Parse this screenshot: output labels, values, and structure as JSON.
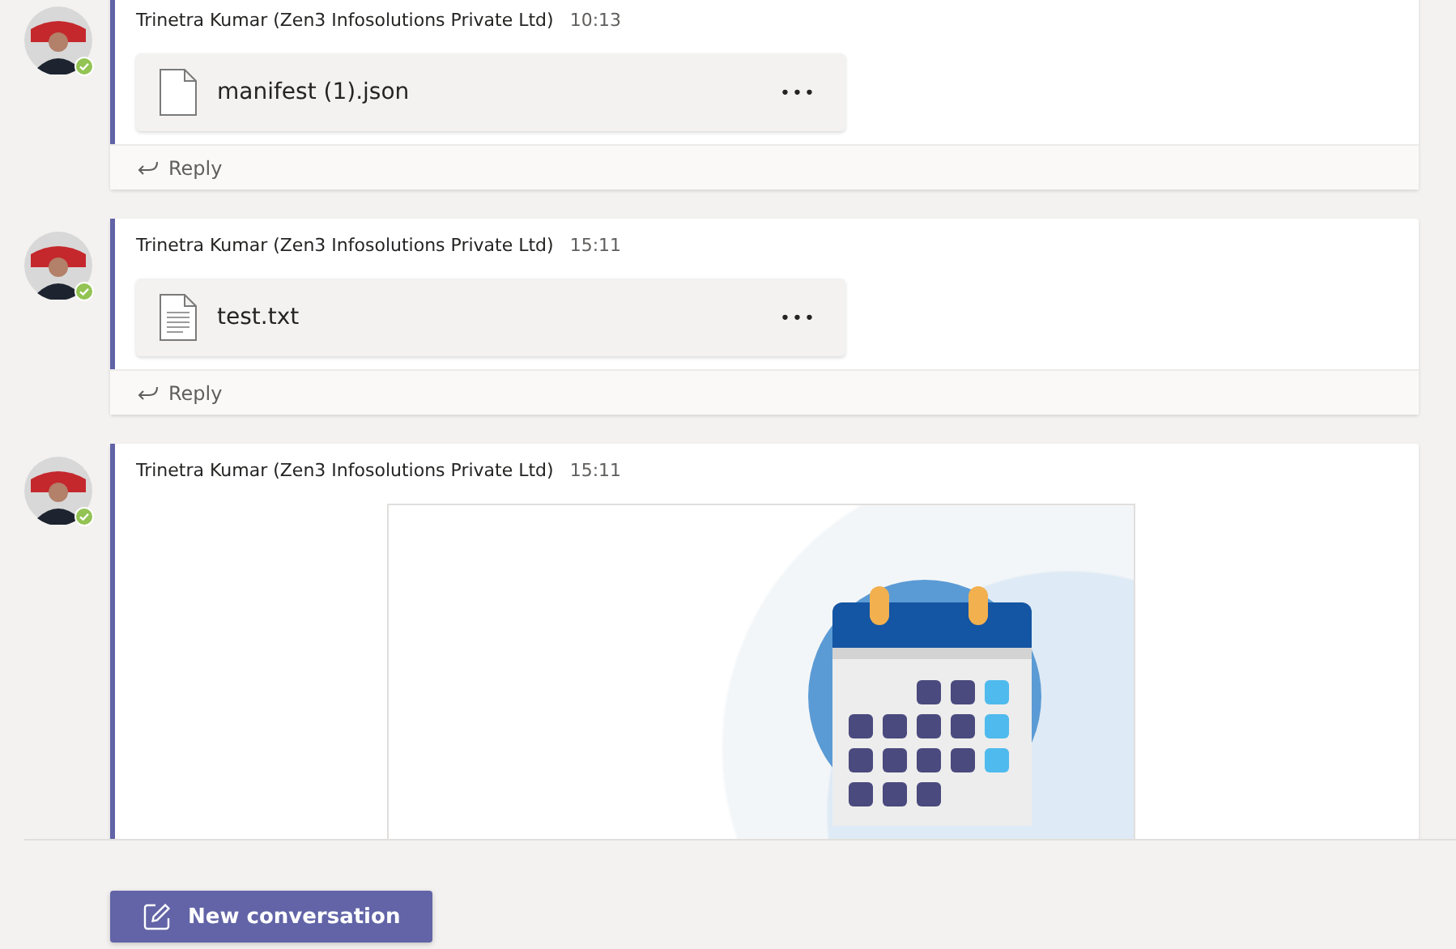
{
  "messages": [
    {
      "author": "Trinetra Kumar (Zen3 Infosolutions Private Ltd)",
      "time": "10:13",
      "kind": "file",
      "attachment": {
        "kind": "blank",
        "name": "manifest (1).json",
        "menu": "•••"
      },
      "reply": "Reply"
    },
    {
      "author": "Trinetra Kumar (Zen3 Infosolutions Private Ltd)",
      "time": "15:11",
      "kind": "file",
      "attachment": {
        "kind": "text",
        "name": "test.txt",
        "menu": "•••"
      },
      "reply": "Reply"
    },
    {
      "author": "Trinetra Kumar (Zen3 Infosolutions Private Ltd)",
      "time": "15:11",
      "kind": "image"
    }
  ],
  "compose": {
    "button": "New conversation"
  }
}
